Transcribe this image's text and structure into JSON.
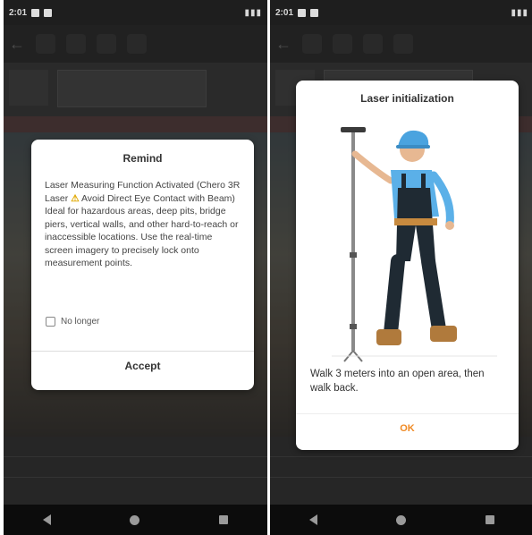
{
  "left_screen": {
    "status_time": "2:01",
    "dialog": {
      "title": "Remind",
      "body_part1": "Laser Measuring Function Activated (Chero 3R Laser ",
      "warning_glyph": "⚠",
      "body_part2": " Avoid Direct Eye Contact with Beam) Ideal for hazardous areas, deep pits, bridge piers, vertical walls, and other hard-to-reach or inaccessible locations. Use the real-time screen imagery to precisely lock onto measurement points.",
      "checkbox_label": "No longer",
      "checkbox_checked": false,
      "accept_label": "Accept"
    }
  },
  "right_screen": {
    "status_time": "2:01",
    "dialog": {
      "title": "Laser initialization",
      "instruction": "Walk 3 meters into an open area, then walk back.",
      "ok_label": "OK"
    }
  },
  "icons": {
    "nav_back": "back-triangle",
    "nav_home": "home-circle",
    "nav_recent": "recent-square"
  },
  "colors": {
    "accent_ok": "#f08a24",
    "warning": "#e0a800",
    "helmet": "#4aa3df",
    "shirt": "#5bb0e8",
    "overalls": "#1f2a33",
    "boots": "#b07a3c"
  }
}
